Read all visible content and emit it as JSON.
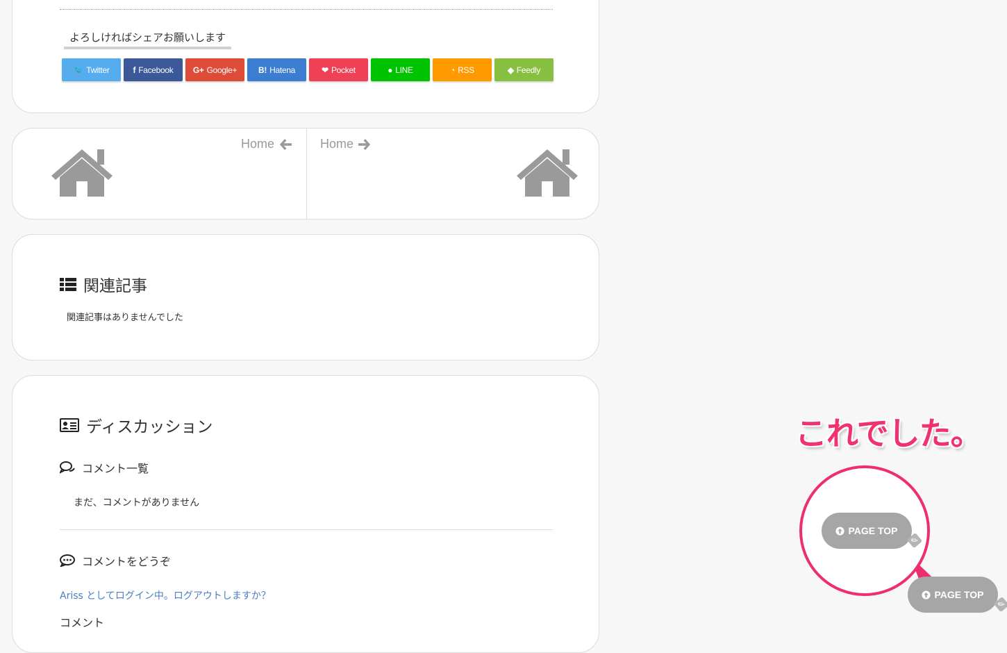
{
  "share": {
    "heading": "よろしければシェアお願いします",
    "buttons": [
      {
        "label": "Twitter",
        "icon": "twitter-icon",
        "glyph": "🐦",
        "color": "#55acee"
      },
      {
        "label": "Facebook",
        "icon": "facebook-icon",
        "glyph": "f",
        "color": "#3b5998"
      },
      {
        "label": "Google+",
        "icon": "googleplus-icon",
        "glyph": "G+",
        "color": "#dd4b39"
      },
      {
        "label": "Hatena",
        "icon": "hatena-icon",
        "glyph": "B!",
        "color": "#3c7dd1"
      },
      {
        "label": "Pocket",
        "icon": "pocket-icon",
        "glyph": "❤",
        "color": "#ef4056"
      },
      {
        "label": "LINE",
        "icon": "line-icon",
        "glyph": "●",
        "color": "#00c300"
      },
      {
        "label": "RSS",
        "icon": "rss-icon",
        "glyph": "◔",
        "color": "#ff9900"
      },
      {
        "label": "Feedly",
        "icon": "feedly-icon",
        "glyph": "◆",
        "color": "#87c040"
      }
    ]
  },
  "post_nav": {
    "prev_label": "Home",
    "next_label": "Home"
  },
  "related": {
    "title": "関連記事",
    "empty_text": "関連記事はありませんでした"
  },
  "discussion": {
    "title": "ディスカッション",
    "comment_list_title": "コメント一覧",
    "no_comments": "まだ、コメントがありません",
    "comment_form_title": "コメントをどうぞ",
    "login_line": "Ariss としてログイン中。ログアウトしますか？",
    "cut_label": "コメント"
  },
  "annotation": {
    "callout": "これでした。",
    "callout_color": "#f0336f"
  },
  "page_top": {
    "label": "PAGE TOP",
    "color": "#a6a6a6"
  }
}
